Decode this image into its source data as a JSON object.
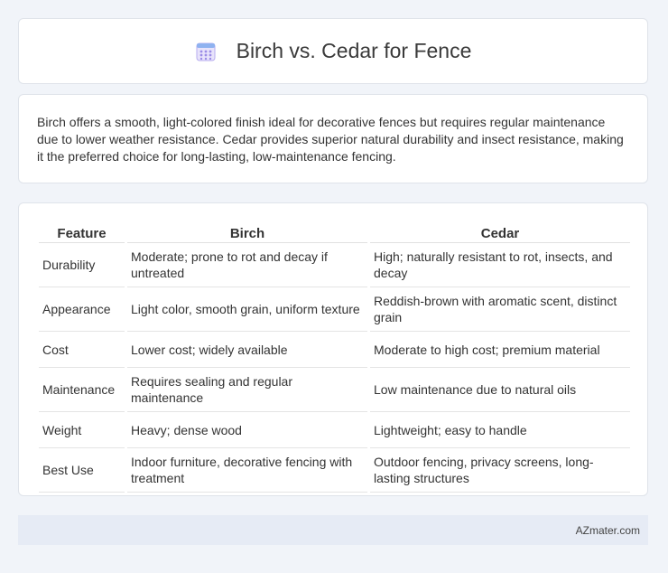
{
  "header": {
    "title": "Birch vs. Cedar for Fence",
    "icon": "calendar-grid-icon",
    "icon_color": "#8a7fe0"
  },
  "summary": "Birch offers a smooth, light-colored finish ideal for decorative fences but requires regular maintenance due to lower weather resistance. Cedar provides superior natural durability and insect resistance, making it the preferred choice for long-lasting, low-maintenance fencing.",
  "table": {
    "headers": [
      "Feature",
      "Birch",
      "Cedar"
    ],
    "rows": [
      [
        "Durability",
        "Moderate; prone to rot and decay if untreated",
        "High; naturally resistant to rot, insects, and decay"
      ],
      [
        "Appearance",
        "Light color, smooth grain, uniform texture",
        "Reddish-brown with aromatic scent, distinct grain"
      ],
      [
        "Cost",
        "Lower cost; widely available",
        "Moderate to high cost; premium material"
      ],
      [
        "Maintenance",
        "Requires sealing and regular maintenance",
        "Low maintenance due to natural oils"
      ],
      [
        "Weight",
        "Heavy; dense wood",
        "Lightweight; easy to handle"
      ],
      [
        "Best Use",
        "Indoor furniture, decorative fencing with treatment",
        "Outdoor fencing, privacy screens, long-lasting structures"
      ]
    ]
  },
  "footer": {
    "brand": "AZmater.com"
  }
}
